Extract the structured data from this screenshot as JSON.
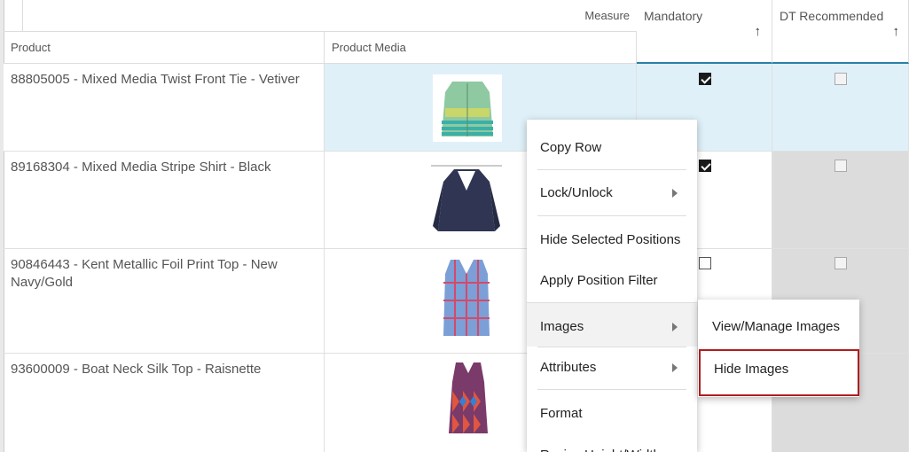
{
  "header": {
    "measure_label": "Measure",
    "product_col": "Product",
    "product_media_col": "Product Media",
    "mandatory_col": "Mandatory",
    "dt_recommended_col": "DT Recommended",
    "sort_arrow": "↑"
  },
  "rows": [
    {
      "product": "88805005 - Mixed Media Twist Front Tie - Vetiver",
      "image": "green-cardigan-image",
      "mandatory": true,
      "dt_recommended": false
    },
    {
      "product": "89168304 - Mixed Media Stripe Shirt - Black",
      "image": "navy-cardigan-image",
      "mandatory": true,
      "dt_recommended": false
    },
    {
      "product": "90846443 - Kent Metallic Foil Print Top - New Navy/Gold",
      "image": "plaid-top-image",
      "mandatory": false,
      "dt_recommended": false
    },
    {
      "product": "93600009 - Boat Neck Silk Top - Raisnette",
      "image": "print-tank-image",
      "mandatory": null,
      "dt_recommended": null
    }
  ],
  "context_menu": {
    "items": [
      "Copy Row",
      "Lock/Unlock",
      "Hide Selected Positions",
      "Apply Position Filter",
      "Images",
      "Attributes",
      "Format",
      "Resize Height/Width"
    ]
  },
  "submenu": {
    "items": [
      "View/Manage Images",
      "Hide Images"
    ]
  },
  "colors": {
    "selected_row": "#dff0f8",
    "highlight_border": "#b01c1c",
    "disabled_cell": "#dcdcdc"
  }
}
